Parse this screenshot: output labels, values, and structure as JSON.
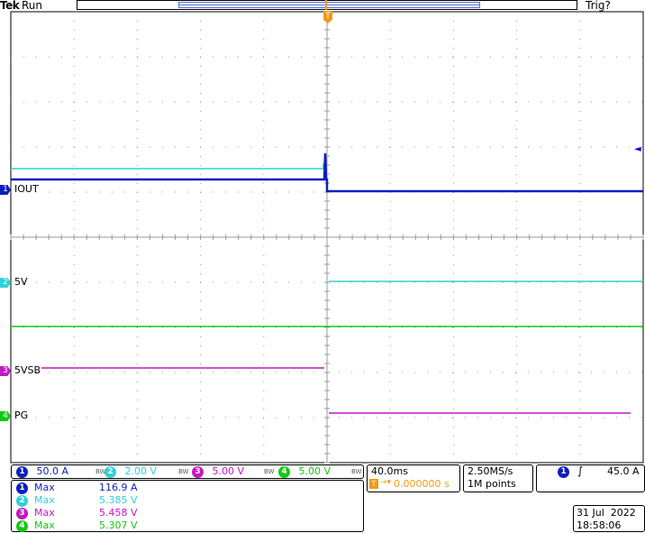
{
  "header": {
    "brand": "Tek",
    "run_state": "Run",
    "trigger_state": "Trig?"
  },
  "trigger_position_marker": "T",
  "trigger_level_marker": "◄",
  "colors": {
    "ch1": "#0a1fbf",
    "ch2": "#2ed1db",
    "ch3": "#c318c3",
    "ch4": "#14c814",
    "trigger": "#f29a16",
    "grid": "#9a9a9a"
  },
  "channels": [
    {
      "number": "1",
      "label": "IOUT",
      "scale": "50.0 A",
      "bw_icon": "BW"
    },
    {
      "number": "2",
      "label": "5V",
      "scale": "2.00 V",
      "bw_icon": "BW"
    },
    {
      "number": "3",
      "label": "5VSB",
      "scale": "5.00 V",
      "bw_icon": "BW"
    },
    {
      "number": "4",
      "label": "PG",
      "scale": "5.00 V",
      "bw_icon": "BW"
    }
  ],
  "measurements": [
    {
      "channel": "1",
      "name": "Max",
      "value": "116.9 A"
    },
    {
      "channel": "2",
      "name": "Max",
      "value": "5.385 V"
    },
    {
      "channel": "3",
      "name": "Max",
      "value": "5.458 V"
    },
    {
      "channel": "4",
      "name": "Max",
      "value": "5.307 V"
    }
  ],
  "timebase": {
    "time_per_div": "40.0ms",
    "trigger_icon": "T",
    "trigger_offset": "0.000000 s",
    "sample_rate": "2.50MS/s",
    "record_length": "1M points"
  },
  "trigger": {
    "source": "1",
    "slope_icon": "rising-edge",
    "slope_glyph": "∫",
    "level": "45.0 A"
  },
  "datetime": {
    "date": "31 Jul  2022",
    "time": "18:58:06"
  }
}
